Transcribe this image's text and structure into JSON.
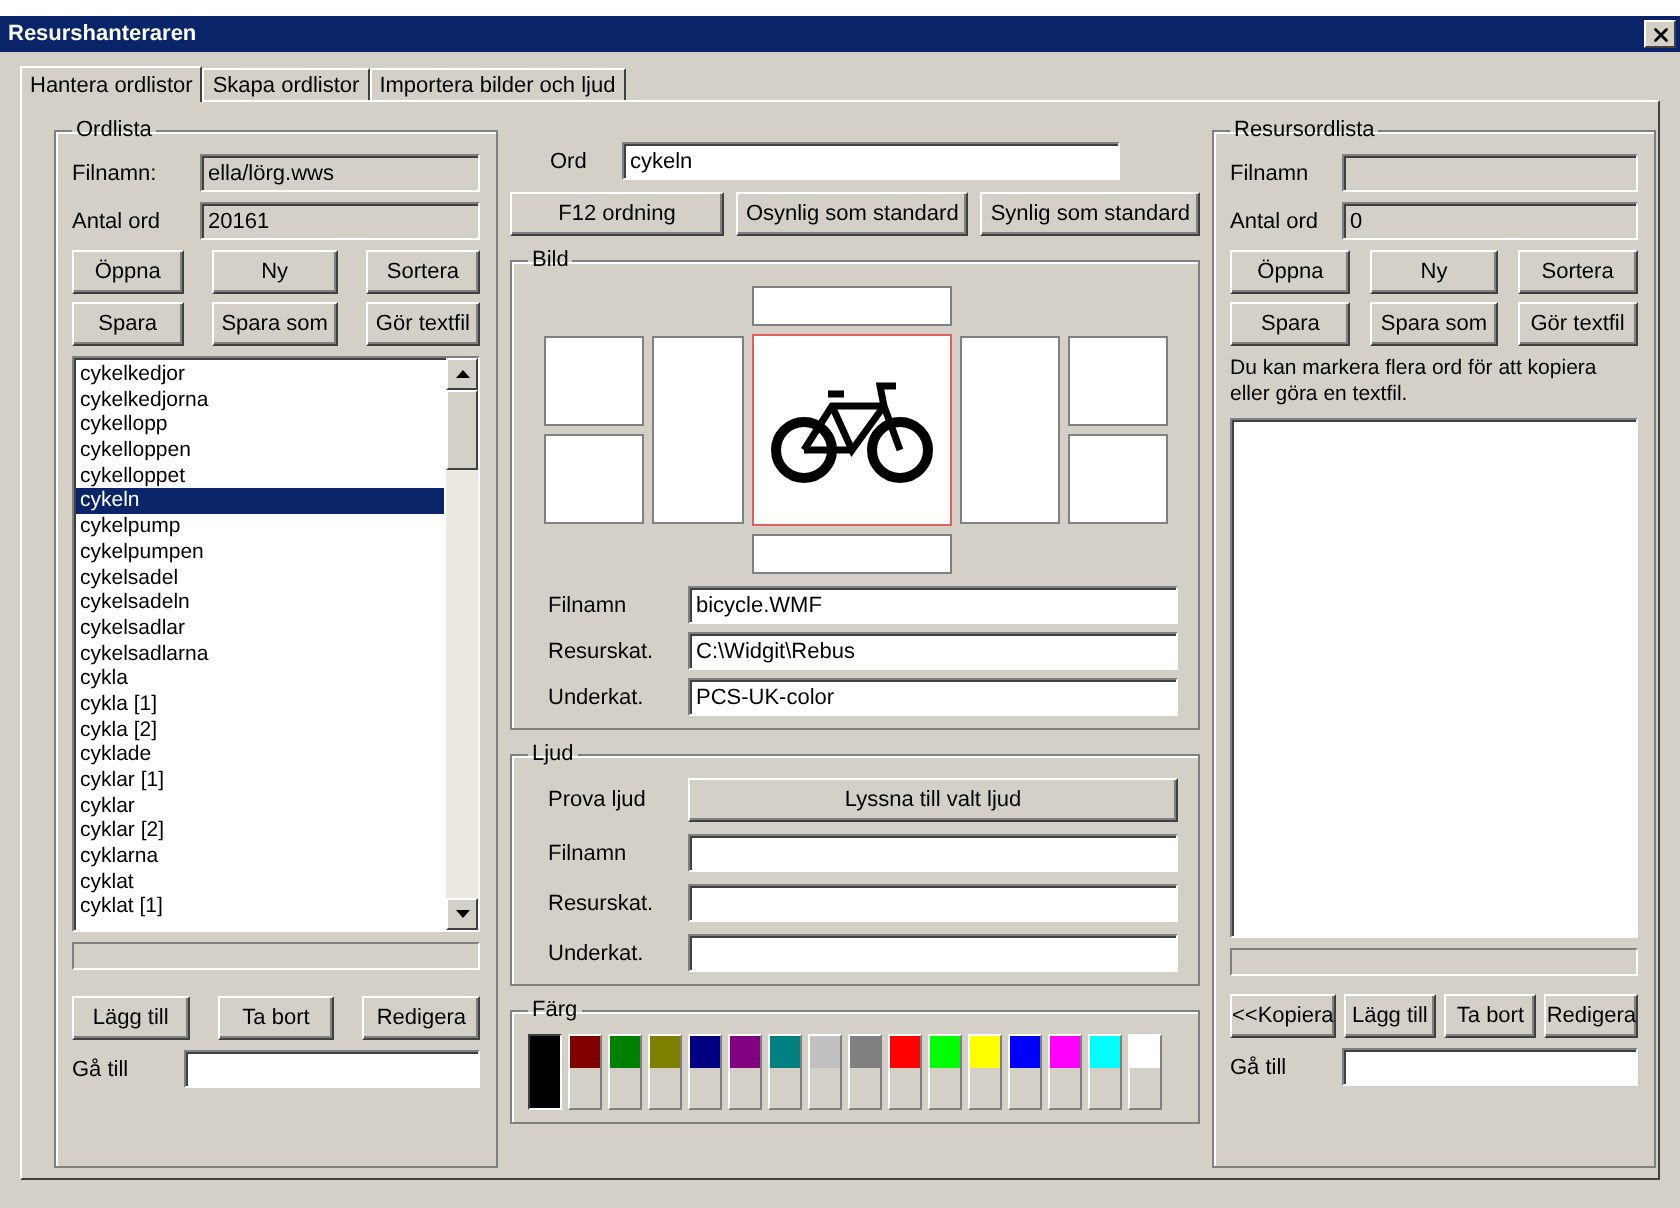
{
  "window": {
    "title": "Resurshanteraren"
  },
  "tabs": [
    {
      "label": "Hantera ordlistor",
      "selected": true
    },
    {
      "label": "Skapa ordlistor",
      "selected": false
    },
    {
      "label": "Importera bilder och ljud",
      "selected": false
    }
  ],
  "word_list": {
    "title": "Ordlista",
    "fields": [
      {
        "label": "Filnamn:",
        "value": "ella/lörg.wws"
      },
      {
        "label": "Antal ord",
        "value": "20161"
      }
    ],
    "buttons": [
      "Öppna",
      "Ny",
      "Sortera",
      "Spara",
      "Spara som",
      "Gör textfil"
    ],
    "items": [
      {
        "label": "cykelkedjor",
        "selected": false
      },
      {
        "label": "cykelkedjorna",
        "selected": false
      },
      {
        "label": "cykellopp",
        "selected": false
      },
      {
        "label": "cykelloppen",
        "selected": false
      },
      {
        "label": "cykelloppet",
        "selected": false
      },
      {
        "label": "cykeln",
        "selected": true
      },
      {
        "label": "cykelpump",
        "selected": false
      },
      {
        "label": "cykelpumpen",
        "selected": false
      },
      {
        "label": "cykelsadel",
        "selected": false
      },
      {
        "label": "cykelsadeln",
        "selected": false
      },
      {
        "label": "cykelsadlar",
        "selected": false
      },
      {
        "label": "cykelsadlarna",
        "selected": false
      },
      {
        "label": "cykla",
        "selected": false
      },
      {
        "label": "cykla [1]",
        "selected": false
      },
      {
        "label": "cykla [2]",
        "selected": false
      },
      {
        "label": "cyklade",
        "selected": false
      },
      {
        "label": "cyklar [1]",
        "selected": false
      },
      {
        "label": "cyklar",
        "selected": false
      },
      {
        "label": "cyklar [2]",
        "selected": false
      },
      {
        "label": "cyklarna",
        "selected": false
      },
      {
        "label": "cyklat",
        "selected": false
      },
      {
        "label": "cyklat [1]",
        "selected": false
      }
    ],
    "bottom_buttons": [
      "Lägg till",
      "Ta bort",
      "Redigera"
    ],
    "goto_label": "Gå till"
  },
  "center": {
    "word": {
      "label": "Ord",
      "value": "cykeln"
    },
    "buttons": [
      "F12 ordning",
      "Osynlig som standard",
      "Synlig som standard"
    ],
    "image": {
      "title": "Bild",
      "fields": [
        {
          "label": "Filnamn",
          "value": "bicycle.WMF"
        },
        {
          "label": "Resurskat.",
          "value": "C:\\Widgit\\Rebus"
        },
        {
          "label": "Underkat.",
          "value": "PCS-UK-color"
        }
      ]
    },
    "sound": {
      "title": "Ljud",
      "test_label": "Prova ljud",
      "test_button": "Lyssna till valt ljud",
      "fields": [
        {
          "label": "Filnamn"
        },
        {
          "label": "Resurskat."
        },
        {
          "label": "Underkat."
        }
      ]
    },
    "color": {
      "title": "Färg",
      "swatches": [
        {
          "color": "#000000",
          "selected": true
        },
        {
          "color": "#800000",
          "selected": false
        },
        {
          "color": "#008000",
          "selected": false
        },
        {
          "color": "#808000",
          "selected": false
        },
        {
          "color": "#000080",
          "selected": false
        },
        {
          "color": "#800080",
          "selected": false
        },
        {
          "color": "#008080",
          "selected": false
        },
        {
          "color": "#c0c0c0",
          "selected": false
        },
        {
          "color": "#808080",
          "selected": false
        },
        {
          "color": "#ff0000",
          "selected": false
        },
        {
          "color": "#00ff00",
          "selected": false
        },
        {
          "color": "#ffff00",
          "selected": false
        },
        {
          "color": "#0000ff",
          "selected": false
        },
        {
          "color": "#ff00ff",
          "selected": false
        },
        {
          "color": "#00ffff",
          "selected": false
        },
        {
          "color": "#ffffff",
          "selected": false
        }
      ]
    }
  },
  "resource_list": {
    "title": "Resursordlista",
    "fields": [
      {
        "label": "Filnamn"
      },
      {
        "label": "Antal ord",
        "value": "0"
      }
    ],
    "buttons": [
      "Öppna",
      "Ny",
      "Sortera",
      "Spara",
      "Spara som",
      "Gör textfil"
    ],
    "hint": "Du kan markera flera ord för att kopiera eller göra en textfil.",
    "bottom_buttons": [
      "<<Kopiera",
      "Lägg till",
      "Ta bort",
      "Redigera"
    ],
    "goto_label": "Gå till"
  }
}
